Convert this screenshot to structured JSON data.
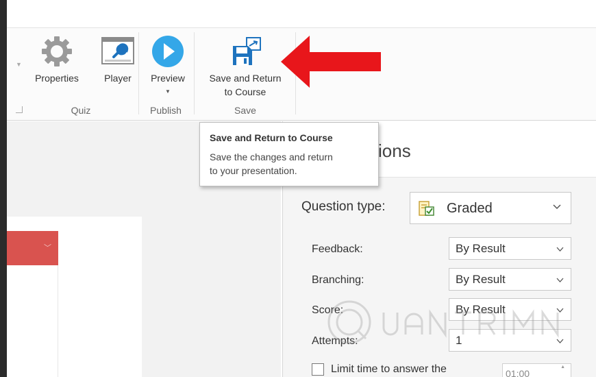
{
  "ribbon": {
    "groups": {
      "quiz": "Quiz",
      "publish": "Publish",
      "save": "Save"
    },
    "buttons": {
      "properties": "Properties",
      "player": "Player",
      "preview": "Preview",
      "save_return_line1": "Save and Return",
      "save_return_line2": "to Course"
    }
  },
  "tooltip": {
    "title": "Save and Return to Course",
    "body_line1": "Save the changes and return",
    "body_line2": "to your presentation."
  },
  "pane": {
    "title_visible": "ions",
    "question_type_label": "Question type:",
    "question_type_value": "Graded",
    "fields": [
      {
        "label": "Feedback:",
        "value": "By Result"
      },
      {
        "label": "Branching:",
        "value": "By Result"
      },
      {
        "label": "Score:",
        "value": "By Result"
      },
      {
        "label": "Attempts:",
        "value": "1"
      }
    ],
    "limit_time_label": "Limit time to answer the",
    "time_value": "01:00"
  },
  "colors": {
    "arrow": "#e8161b",
    "preview_icon": "#34a7e8",
    "save_icon": "#1e73be",
    "red_bar": "#d9534f"
  }
}
